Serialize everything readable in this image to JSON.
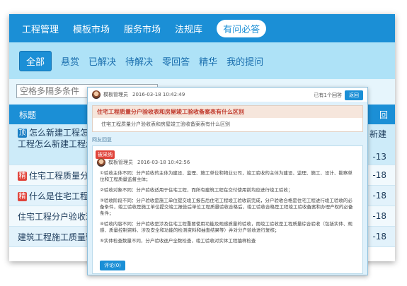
{
  "nav": {
    "items": [
      "工程管理",
      "模板市场",
      "服务市场",
      "法规库",
      "有问必答"
    ],
    "active_index": 4
  },
  "filters": {
    "tabs": [
      "全部",
      "悬赏",
      "已解决",
      "待解决",
      "零回答",
      "精华",
      "我的提问"
    ],
    "active_index": 0
  },
  "search": {
    "placeholder": "空格多隔多条件"
  },
  "table": {
    "header_left": "标题",
    "header_right": "回",
    "rows": [
      {
        "badge": "顶",
        "title_line1": "怎么新建工程怎么",
        "title_line2": "工程怎么新建工程怎",
        "side_line1": "新建",
        "side_line2": "-13"
      },
      {
        "badge": "精",
        "title_line1": "住宅工程质量分户",
        "side_line1": "-18"
      },
      {
        "badge": "精",
        "title_line1": "什么是住宅工程",
        "side_line1": "-18"
      },
      {
        "badge": "",
        "title_line1": "住宅工程分户验收现",
        "side_line1": "-18"
      },
      {
        "badge": "",
        "title_line1": "建筑工程施工质量验",
        "side_line1": "-18"
      }
    ]
  },
  "question": {
    "user": "模板管理员",
    "time": "2016-03-18 10:42:49",
    "meta": "已有1个回答",
    "back_label": "返回",
    "title": "住宅工程质量分户验收表和房屋竣工验收备案表有什么区别",
    "body": "住宅工程质量分户验收表和房屋竣工验收备案表有什么区别"
  },
  "replies_label": "网友回复",
  "reply": {
    "tag": "被采纳",
    "user": "模板管理员",
    "time": "2016-03-18 10:42:56",
    "paragraphs": [
      "①验收主体不同：分户验收的主体为建设、监理、施工单位和物业公司，竣工验收的主体为建设、监理、施工、设计、勘察单位和工程质量监督主体；",
      "②验收对象不同：分户验收适用于住宅工程，而所有建筑工程在交付使用前均应进行竣工验收；",
      "③验收阶段不同：分户验收是施工单位提交竣工报告后住宅工程竣工验收前完成，分户验收合格是住宅工程进行竣工验收的必备条件，竣工验收是施工单位提交竣工报告后单位工程质量验收合格后，竣工验收合格是工程竣工验收备案和办理产权的必备条件；",
      "④验收内容不同：分户验收是涉及住宅工程重要使用功能及观感质量的验收，而竣工验收是工程质量综合验收（包括实体、观感、质量控制资料、涉及安全和功能的检测资料和抽查结果等）并对分户验收进行复核；",
      "⑤实体检查数量不同，分户验收逐户全数检查，竣工验收对实体工程抽样检查"
    ],
    "comment_label": "评论(0)"
  },
  "colors": {
    "primary": "#1b8fd6",
    "filter_bg": "#aee2f7",
    "badge_red": "#e0443b",
    "badge_blue": "#1b7fc4"
  }
}
